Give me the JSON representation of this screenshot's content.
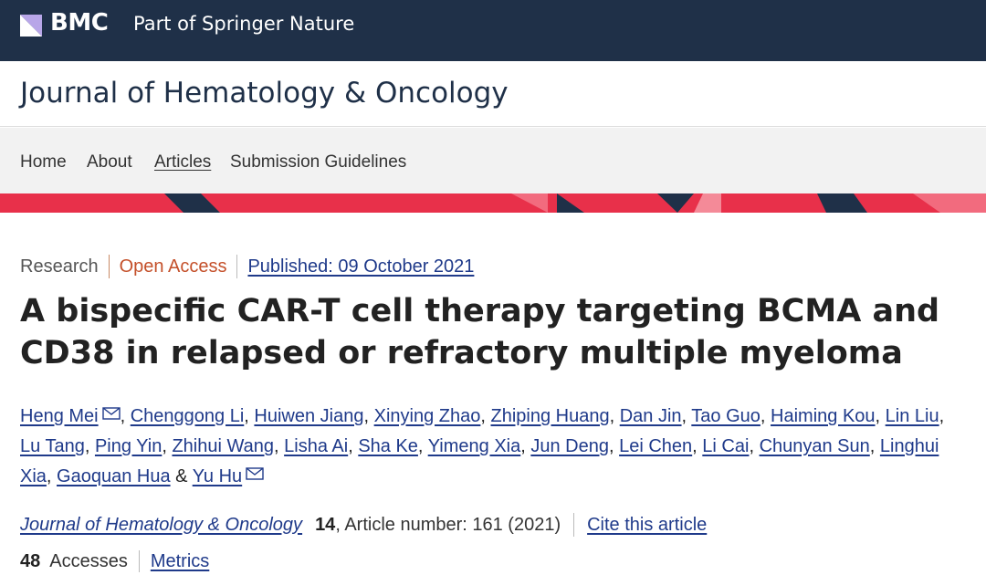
{
  "brand": {
    "logo_text": "BMC",
    "tagline": "Part of Springer Nature"
  },
  "journal": {
    "title": "Journal of Hematology & Oncology"
  },
  "nav": {
    "items": [
      {
        "label": "Home",
        "active": false
      },
      {
        "label": "About",
        "active": false
      },
      {
        "label": "Articles",
        "active": true
      },
      {
        "label": "Submission Guidelines",
        "active": false
      }
    ]
  },
  "article": {
    "type": "Research",
    "access": "Open Access",
    "published": "Published: 09 October 2021",
    "title": "A bispecific CAR-T cell therapy targeting BCMA and CD38 in relapsed or refractory multiple myeloma",
    "authors": [
      "Heng Mei",
      "Chenggong Li",
      "Huiwen Jiang",
      "Xinying Zhao",
      "Zhiping Huang",
      "Dan Jin",
      "Tao Guo",
      "Haiming Kou",
      "Lin Liu",
      "Lu Tang",
      "Ping Yin",
      "Zhihui Wang",
      "Lisha Ai",
      "Sha Ke",
      "Yimeng Xia",
      "Jun Deng",
      "Lei Chen",
      "Li Cai",
      "Chunyan Sun",
      "Linghui Xia",
      "Gaoquan Hua",
      "Yu Hu"
    ],
    "corresponding_authors": [
      "Heng Mei",
      "Yu Hu"
    ],
    "author_joiner": "&",
    "citation": {
      "journal": "Journal of Hematology & Oncology",
      "volume": "14",
      "details": ", Article number: 161 (2021)",
      "cite_link": "Cite this article"
    },
    "metrics": {
      "accesses_count": "48",
      "accesses_label": "Accesses",
      "metrics_link": "Metrics"
    }
  },
  "colors": {
    "header_bg": "#1f3048",
    "accent_red": "#e8304a",
    "link_blue": "#1f3a8a",
    "open_access_orange": "#c4502a"
  }
}
